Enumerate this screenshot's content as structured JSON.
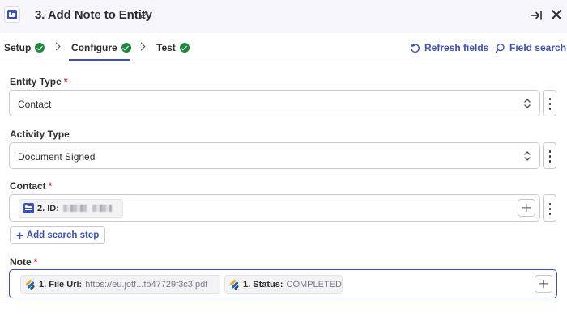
{
  "header": {
    "title": "3. Add Note to Entity"
  },
  "tabs": [
    {
      "label": "Setup",
      "complete": true
    },
    {
      "label": "Configure",
      "complete": true,
      "active": true
    },
    {
      "label": "Test",
      "complete": true
    }
  ],
  "actions": {
    "refresh": "Refresh fields",
    "search": "Field search"
  },
  "fields": {
    "entity_type": {
      "label": "Entity Type",
      "required": "*",
      "value": "Contact"
    },
    "activity_type": {
      "label": "Activity Type",
      "value": "Document Signed"
    },
    "contact": {
      "label": "Contact",
      "required": "*",
      "pill_key": "2. ID:"
    },
    "add_search_step": "Add search step",
    "note": {
      "label": "Note",
      "required": "*",
      "pills": [
        {
          "key": "1. File Url:",
          "value": "https://eu.jotf...fb47729f3c3.pdf"
        },
        {
          "key": "1. Status:",
          "value": "COMPLETED"
        }
      ]
    }
  },
  "colors": {
    "accent": "#3d4fb8",
    "success": "#1f8a3f",
    "required": "#d6334a"
  }
}
